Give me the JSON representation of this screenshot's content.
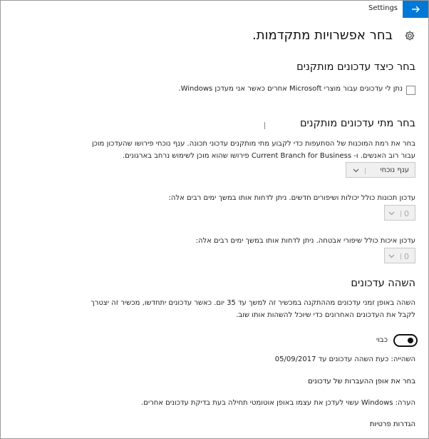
{
  "window": {
    "app_title": "Settings"
  },
  "page": {
    "title": "בחר אפשרויות מתקדמות."
  },
  "install_section": {
    "heading": "בחר כיצד עדכונים מותקנים",
    "checkbox_label": "נתן לי עדכונים עבור מוצרי Microsoft אחרים כאשר אני מעדכן Windows."
  },
  "when_section": {
    "heading": "בחר מתי עדכונים מותקנים",
    "description_line1": "בחר את רמת המוכנות של הסתעפות כדי לקבוע מתי מותקנים עדכוני תכונה.  ענף נוכחי פירושו שהעדכון מוכן",
    "description_line2": "עבור רוב האנשים. ו- Current Branch for Business פירושו שהוא מוכן לשימוש נרחב בארגונים.",
    "branch_dropdown_value": "ענף נוכחי",
    "feature_defer_label": "עדכון תכונות כולל יכולות ושיפורים חדשים. ניתן לדחות אותו במשך ימים רבים אלה:",
    "feature_defer_value": "0",
    "quality_defer_label": "עדכון איכות כולל שיפורי אבטחה. ניתן לדחות אותו במשך ימים רבים אלה:",
    "quality_defer_value": "0"
  },
  "pause_section": {
    "heading": "השהה עדכונים",
    "description_line1": "השהה באופן זמני עדכונים מההתקנה במכשיר זה למשך עד 35 יום. כאשר עדכונים יתחדשו, מכשיר זה יצטרך",
    "description_line2": "לקבל את העדכונים האחרונים כדי שיוכל להשהות אותו שוב.",
    "toggle_label": "כבוי",
    "toggle_on": true,
    "pause_info": "השהייה: כעת השהה עדכונים עד 05/09/2017"
  },
  "links": {
    "delivery": "בחר את אופן ההעברות של עדכונים",
    "note": "הערה: Windows עשוי לעדכן את עצמו באופן אוטומטי תחילה בעת בדיקת עדכונים אחרים.",
    "privacy": "הגדרות פרטיות"
  },
  "colors": {
    "accent": "#0078d7"
  }
}
